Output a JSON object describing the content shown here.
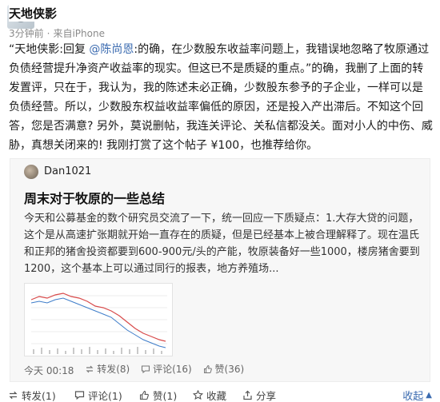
{
  "header": {
    "author": "天地侠影",
    "time": "3分钟前",
    "source": "来自iPhone"
  },
  "post": {
    "prefix": "“天地侠影:回复 ",
    "mention": "@陈尚恩",
    "body": ":的确，在少数股东收益率问题上，我错误地忽略了牧原通过负债经营提升净资产收益率的现实。但这已不是质疑的重点。”的确，我删了上面的转发置评，只在于，我认为，我的陈述未必正确，少数股东参予的子企业，一样可以是负债经营。所以，少数股东权益收益率偏低的原因，还是投入产出滞后。不知这个回答，您是否满意? 另外，莫说删帖，我连关评论、关私信都没关。面对小人的中伤、威胁，真想关闭来的! 我刚打赏了这个帖子 ¥100，也推荐给你。"
  },
  "card": {
    "author": "Dan1021",
    "title": "周末对于牧原的一些总结",
    "excerpt": "今天和公募基金的数个研究员交流了一下，统一回应一下质疑点：1.大存大贷的问题，这个是从高速扩张期就开始一直存在的质疑，但是已经基本上被合理解释了。现在温氏和正邦的猪舍投资都要到600-900元/头的产能，牧原装备好一些1000，楼房猪舍要到1200，这个基本上可以通过同行的报表，地方养殖场...",
    "stats": {
      "time": "今天 00:18",
      "reposts": "转发(8)",
      "comments": "评论(16)",
      "likes": "赞(36)"
    }
  },
  "actions": {
    "repost": "转发(1)",
    "comment": "评论(1)",
    "like": "赞(1)",
    "favorite": "收藏",
    "share": "分享",
    "collapse": "收起"
  },
  "colors": {
    "link": "#3b6bb0",
    "text": "#1a1a1a",
    "muted": "#8a8a8a",
    "card_bg": "#f7f7f7",
    "thumb_line_red": "#d84a4a",
    "thumb_line_blue": "#3d7cc9"
  },
  "icons": {
    "repost": "repost-icon",
    "comment": "comment-icon",
    "like": "thumb-up-icon",
    "favorite": "star-icon",
    "share": "share-icon",
    "collapse": "chevron-up-icon"
  }
}
